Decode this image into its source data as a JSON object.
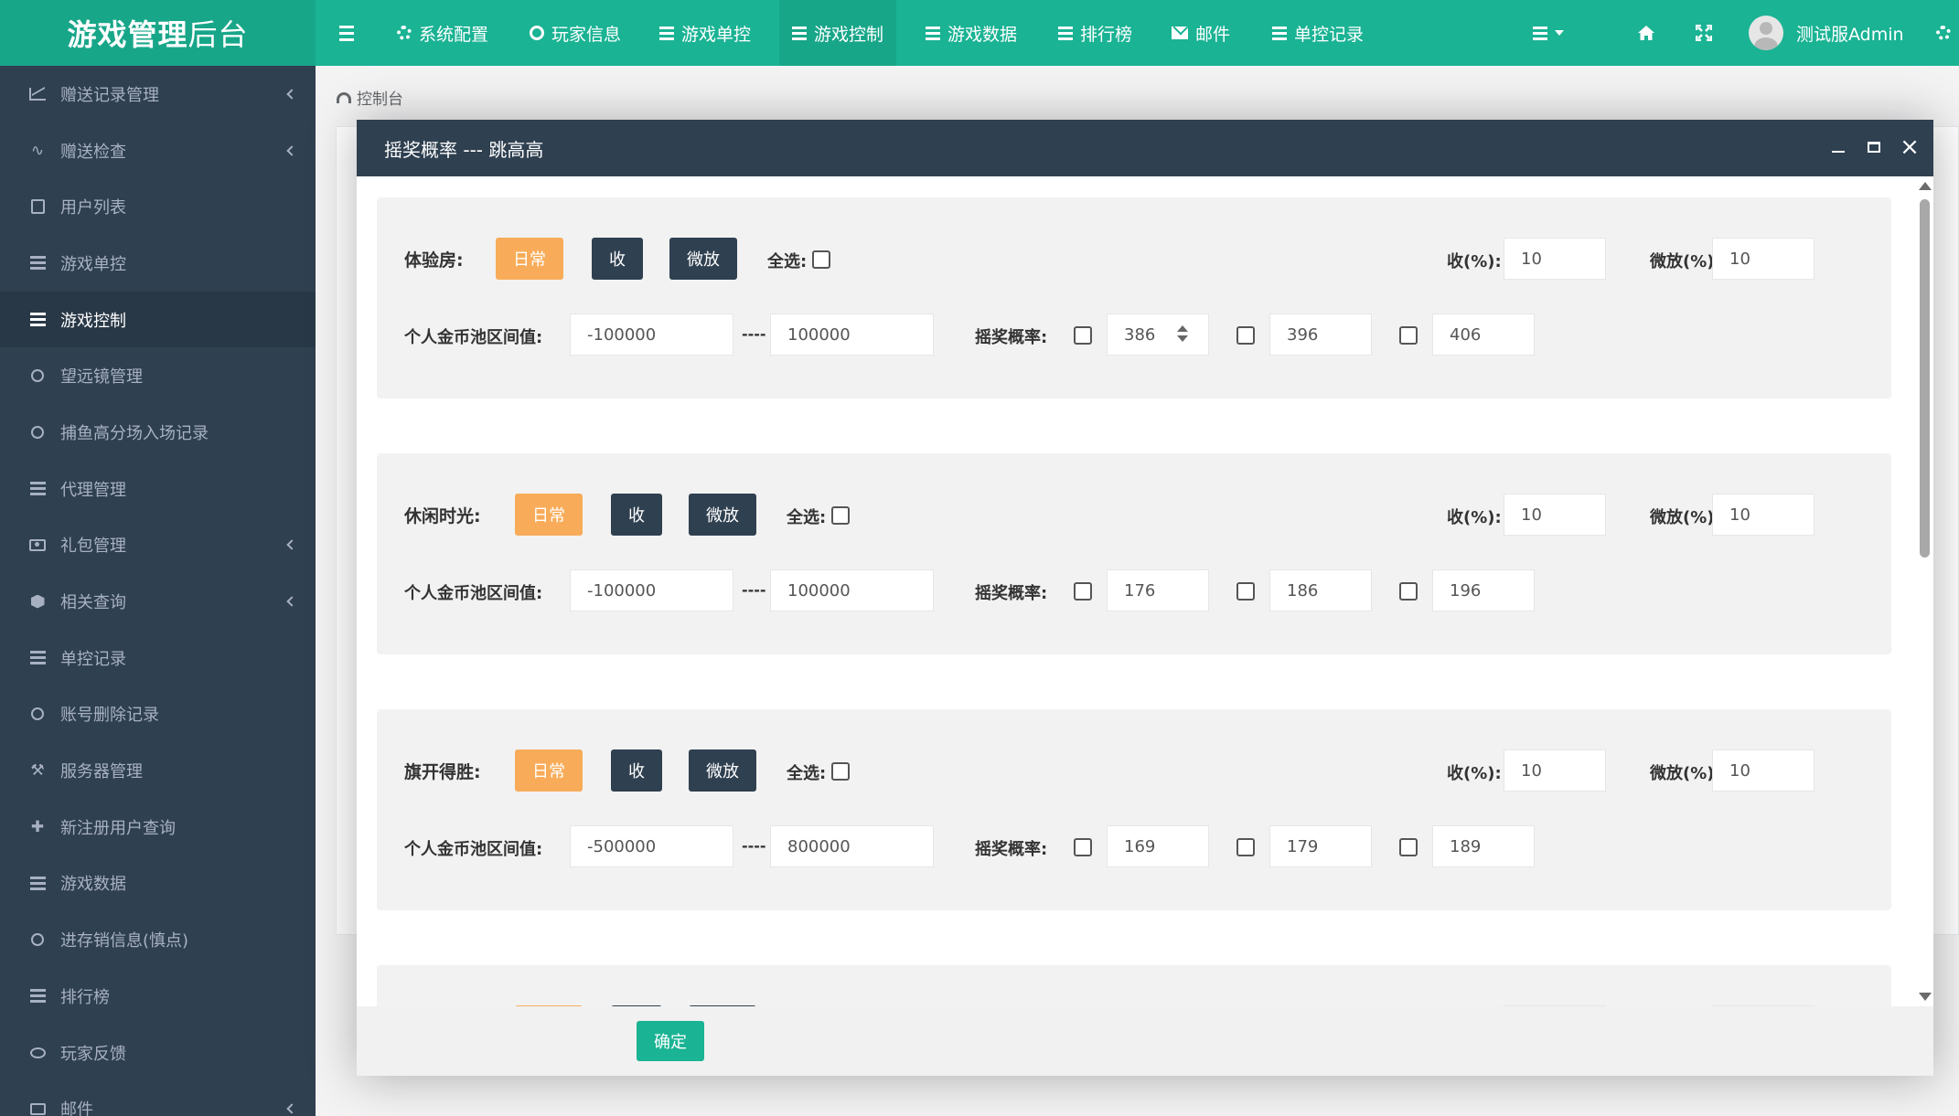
{
  "app": {
    "logo_bold": "游戏管理",
    "logo_thin": "后台"
  },
  "topnav": [
    {
      "label": "系统配置",
      "icon": "gear-icon"
    },
    {
      "label": "玩家信息",
      "icon": "circle-icon"
    },
    {
      "label": "游戏单控",
      "icon": "list-icon"
    },
    {
      "label": "游戏控制",
      "icon": "list-icon",
      "active": true
    },
    {
      "label": "游戏数据",
      "icon": "list-icon"
    },
    {
      "label": "排行榜",
      "icon": "list-icon"
    },
    {
      "label": "邮件",
      "icon": "envelope-icon"
    },
    {
      "label": "单控记录",
      "icon": "list-icon"
    }
  ],
  "user": {
    "name": "测试服Admin"
  },
  "sidebar": [
    {
      "label": "赠送记录管理",
      "icon": "line-chart-icon",
      "has_children": true
    },
    {
      "label": "赠送检查",
      "icon": "pulse-icon",
      "has_children": true
    },
    {
      "label": "用户列表",
      "icon": "user-card-icon",
      "has_children": false
    },
    {
      "label": "游戏单控",
      "icon": "list-icon",
      "has_children": false
    },
    {
      "label": "游戏控制",
      "icon": "list-icon",
      "has_children": false,
      "active": true
    },
    {
      "label": "望远镜管理",
      "icon": "circle-icon",
      "has_children": false
    },
    {
      "label": "捕鱼高分场入场记录",
      "icon": "circle-icon",
      "has_children": false
    },
    {
      "label": "代理管理",
      "icon": "list-icon",
      "has_children": false
    },
    {
      "label": "礼包管理",
      "icon": "gift-icon",
      "has_children": true
    },
    {
      "label": "相关查询",
      "icon": "cube-icon",
      "has_children": true
    },
    {
      "label": "单控记录",
      "icon": "list-icon",
      "has_children": false
    },
    {
      "label": "账号删除记录",
      "icon": "circle-icon",
      "has_children": false
    },
    {
      "label": "服务器管理",
      "icon": "gavel-icon",
      "has_children": false
    },
    {
      "label": "新注册用户查询",
      "icon": "puzzle-icon",
      "has_children": false
    },
    {
      "label": "游戏数据",
      "icon": "list-icon",
      "has_children": false
    },
    {
      "label": "进存销信息(慎点)",
      "icon": "circle-icon",
      "has_children": false
    },
    {
      "label": "排行榜",
      "icon": "list-icon",
      "has_children": false
    },
    {
      "label": "玩家反馈",
      "icon": "comment-icon",
      "has_children": false
    },
    {
      "label": "邮件",
      "icon": "envelope-icon",
      "has_children": true
    }
  ],
  "breadcrumb": "控制台",
  "modal": {
    "title": "摇奖概率 --- 跳高高",
    "confirm_label": "确定",
    "labels": {
      "btn_normal": "日常",
      "btn_shou": "收",
      "btn_weifang": "微放",
      "select_all": "全选:",
      "shou_pct": "收(%):",
      "weifang_pct": "微放(%):",
      "pool_range": "个人金币池区间值:",
      "range_sep": "----",
      "prob": "摇奖概率:"
    },
    "games": [
      {
        "name": "体验房:",
        "shou": "10",
        "weifang": "10",
        "pool_min": "-100000",
        "pool_max": "100000",
        "probs": [
          "386",
          "396",
          "406"
        ]
      },
      {
        "name": "休闲时光:",
        "shou": "10",
        "weifang": "10",
        "pool_min": "-100000",
        "pool_max": "100000",
        "probs": [
          "176",
          "186",
          "196"
        ]
      },
      {
        "name": "旗开得胜:",
        "shou": "10",
        "weifang": "10",
        "pool_min": "-500000",
        "pool_max": "800000",
        "probs": [
          "169",
          "179",
          "189"
        ]
      }
    ]
  },
  "colors": {
    "primary": "#1ab394",
    "sidebar_bg": "#2f4050",
    "orange": "#f8ac59"
  }
}
